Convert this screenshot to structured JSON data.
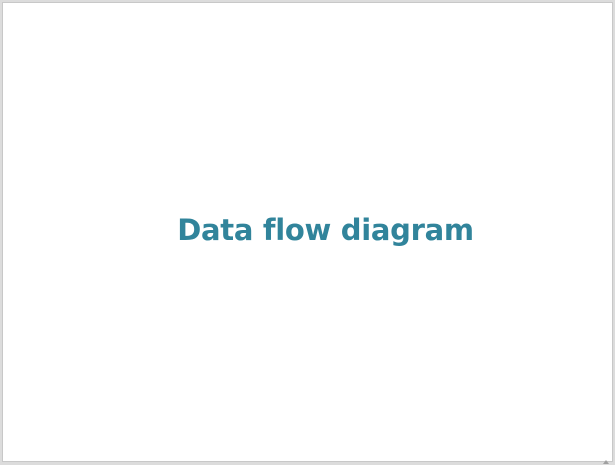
{
  "slide": {
    "title": "Data flow diagram"
  },
  "colors": {
    "title": "#31849b",
    "slide_background": "#ffffff",
    "frame": "#dcdcdc"
  },
  "icons": {
    "resize_grip": "caret-up-icon"
  }
}
